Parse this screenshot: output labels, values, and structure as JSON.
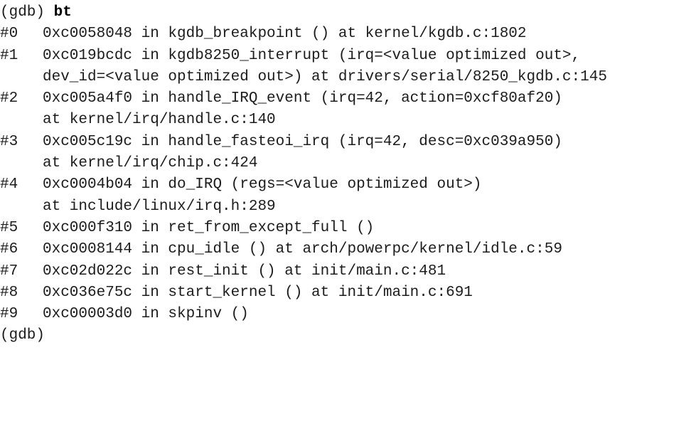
{
  "terminal": {
    "prompt": "(gdb) ",
    "command": "bt",
    "frames": [
      {
        "num": "#0",
        "lines": [
          "0xc0058048 in kgdb_breakpoint () at kernel/kgdb.c:1802"
        ]
      },
      {
        "num": "#1",
        "lines": [
          "0xc019bcdc in kgdb8250_interrupt (irq=<value optimized out>,",
          "dev_id=<value optimized out>) at drivers/serial/8250_kgdb.c:145"
        ]
      },
      {
        "num": "#2",
        "lines": [
          "0xc005a4f0 in handle_IRQ_event (irq=42, action=0xcf80af20)",
          "at kernel/irq/handle.c:140"
        ]
      },
      {
        "num": "#3",
        "lines": [
          "0xc005c19c in handle_fasteoi_irq (irq=42, desc=0xc039a950)",
          "at kernel/irq/chip.c:424"
        ]
      },
      {
        "num": "#4",
        "lines": [
          "0xc0004b04 in do_IRQ (regs=<value optimized out>)",
          "at include/linux/irq.h:289"
        ]
      },
      {
        "num": "#5",
        "lines": [
          "0xc000f310 in ret_from_except_full ()"
        ]
      },
      {
        "num": "#6",
        "lines": [
          "0xc0008144 in cpu_idle () at arch/powerpc/kernel/idle.c:59"
        ]
      },
      {
        "num": "#7",
        "lines": [
          "0xc02d022c in rest_init () at init/main.c:481"
        ]
      },
      {
        "num": "#8",
        "lines": [
          "0xc036e75c in start_kernel () at init/main.c:691"
        ]
      },
      {
        "num": "#9",
        "lines": [
          "0xc00003d0 in skpinv ()"
        ]
      }
    ],
    "final_prompt": "(gdb)"
  }
}
